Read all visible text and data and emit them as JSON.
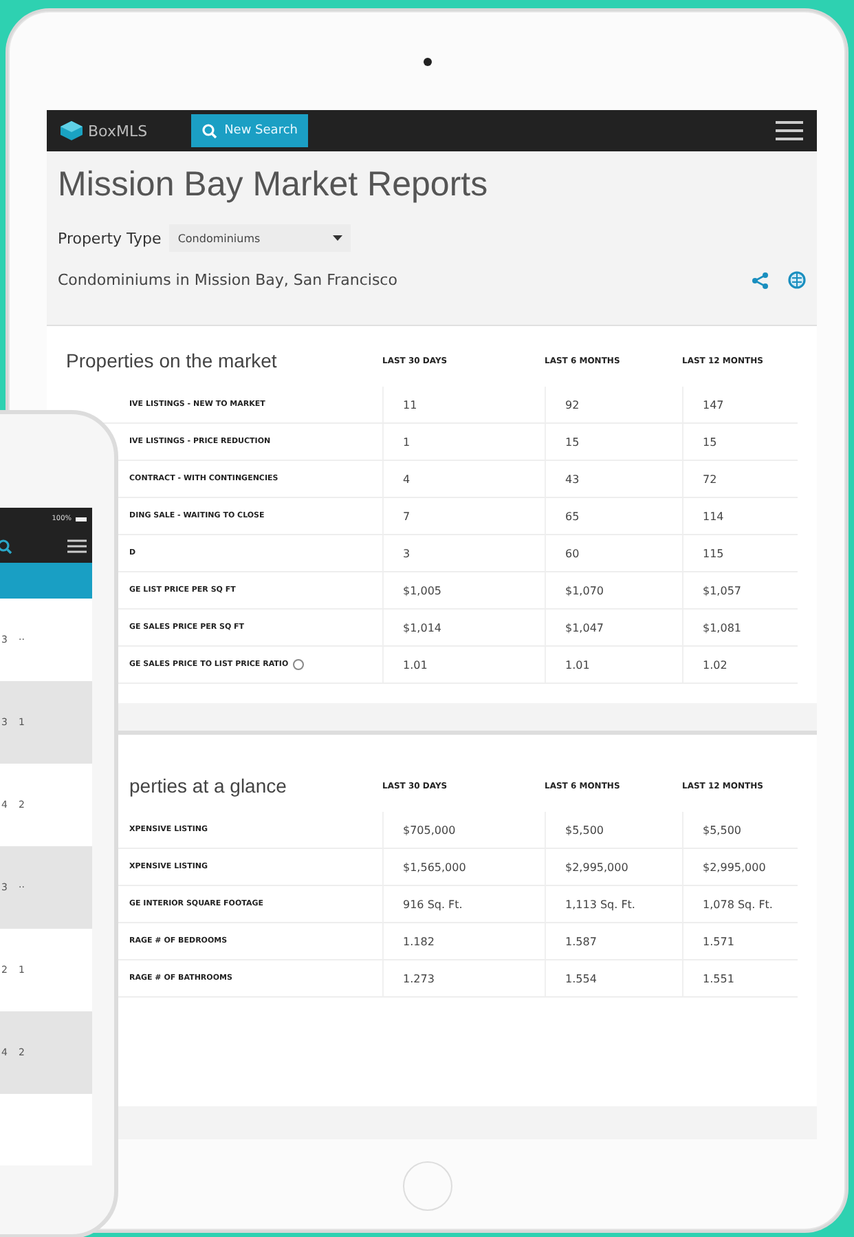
{
  "app_bar": {
    "logo": "BoxMLS",
    "search_button": "New Search"
  },
  "page": {
    "title": "Mission Bay Market Reports",
    "filter_label": "Property Type",
    "filter_value": "Condominiums",
    "subtitle": "Condominiums in Mission Bay, San Francisco"
  },
  "sections": [
    {
      "title": "Properties on the market",
      "columns": [
        "LAST 30 DAYS",
        "LAST 6 MONTHS",
        "LAST 12 MONTHS"
      ],
      "rows": [
        {
          "label": "IVE LISTINGS - NEW TO MARKET",
          "values": [
            "11",
            "92",
            "147"
          ],
          "info": false
        },
        {
          "label": "IVE LISTINGS - PRICE REDUCTION",
          "values": [
            "1",
            "15",
            "15"
          ],
          "info": false
        },
        {
          "label": "CONTRACT - WITH CONTINGENCIES",
          "values": [
            "4",
            "43",
            "72"
          ],
          "info": false
        },
        {
          "label": "DING SALE - WAITING TO CLOSE",
          "values": [
            "7",
            "65",
            "114"
          ],
          "info": false
        },
        {
          "label": "D",
          "values": [
            "3",
            "60",
            "115"
          ],
          "info": false
        },
        {
          "label": "GE LIST PRICE PER SQ FT",
          "values": [
            "$1,005",
            "$1,070",
            "$1,057"
          ],
          "info": false
        },
        {
          "label": "GE SALES PRICE PER SQ FT",
          "values": [
            "$1,014",
            "$1,047",
            "$1,081"
          ],
          "info": false
        },
        {
          "label": "GE SALES PRICE TO LIST PRICE RATIO",
          "values": [
            "1.01",
            "1.01",
            "1.02"
          ],
          "info": true
        }
      ]
    },
    {
      "title": "perties at a glance",
      "columns": [
        "LAST 30 DAYS",
        "LAST 6 MONTHS",
        "LAST 12 MONTHS"
      ],
      "rows": [
        {
          "label": "XPENSIVE LISTING",
          "values": [
            "$705,000",
            "$5,500",
            "$5,500"
          ],
          "info": false
        },
        {
          "label": "XPENSIVE LISTING",
          "values": [
            "$1,565,000",
            "$2,995,000",
            "$2,995,000"
          ],
          "info": false
        },
        {
          "label": "GE INTERIOR SQUARE FOOTAGE",
          "values": [
            "916 Sq. Ft.",
            "1,113 Sq. Ft.",
            "1,078 Sq. Ft."
          ],
          "info": false
        },
        {
          "label": "RAGE # OF BEDROOMS",
          "values": [
            "1.182",
            "1.587",
            "1.571"
          ],
          "info": false
        },
        {
          "label": "RAGE # OF BATHROOMS",
          "values": [
            "1.273",
            "1.554",
            "1.551"
          ],
          "info": false
        }
      ]
    }
  ],
  "phone": {
    "battery": "100%",
    "listings": [
      {
        "beds": "3",
        "baths": "··",
        "shaded": false
      },
      {
        "beds": "3",
        "baths": "1",
        "shaded": true
      },
      {
        "beds": "4",
        "baths": "2",
        "shaded": false
      },
      {
        "beds": "3",
        "baths": "··",
        "shaded": true
      },
      {
        "beds": "2",
        "baths": "1",
        "shaded": false
      },
      {
        "beds": "4",
        "baths": "2",
        "shaded": true
      }
    ]
  }
}
